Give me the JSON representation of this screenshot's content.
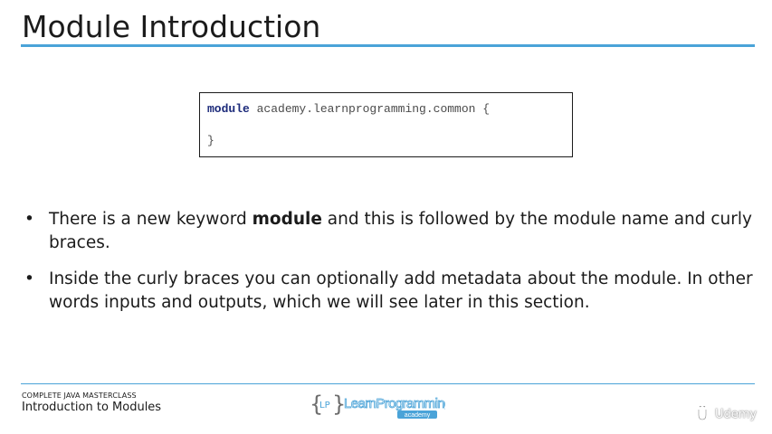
{
  "slide": {
    "title": "Module Introduction"
  },
  "code": {
    "keyword": "module",
    "rest_line1": " academy.learnprogramming.common {",
    "line2": "}"
  },
  "bullets": [
    {
      "before": "There is a new keyword ",
      "bold": "module",
      "after": " and this is followed by the module name and curly braces."
    },
    {
      "text": "Inside the curly braces you can optionally add metadata about the module. In other words inputs and outputs, which we will see later in this section."
    }
  ],
  "bullet_symbol": "•",
  "footer": {
    "course": "COMPLETE JAVA MASTERCLASS",
    "section": "Introduction to Modules",
    "logo_left_brace": "{",
    "logo_lp": "LP",
    "logo_right_brace": "}",
    "logo_name": "LearnProgramming",
    "logo_sub": "academy",
    "watermark": "Udemy"
  },
  "colors": {
    "accent": "#4aa3d8",
    "keyword": "#1c2a7a",
    "text": "#1b1b1b"
  },
  "icons": {
    "logo": "learnprogramming-logo",
    "watermark": "udemy-logo-icon"
  }
}
